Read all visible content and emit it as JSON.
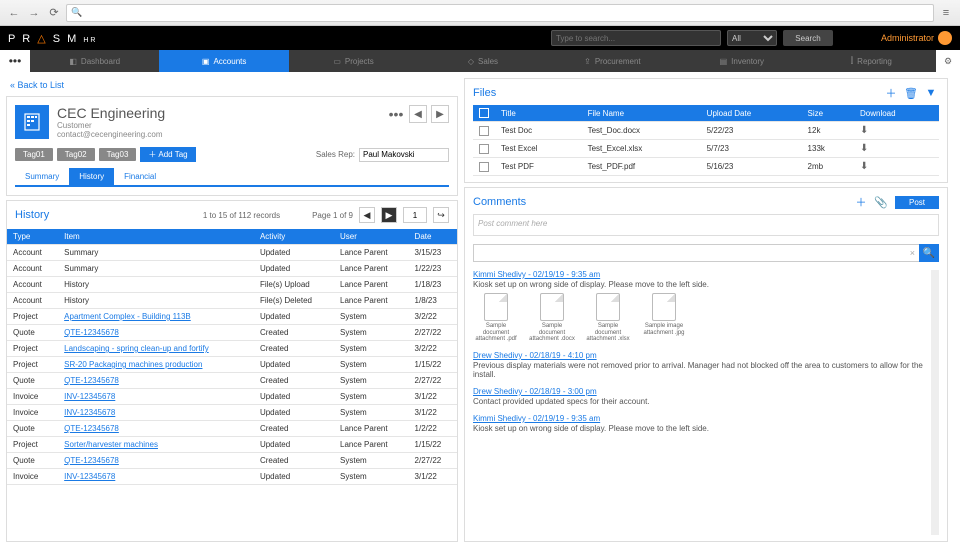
{
  "browser": {
    "url_icon": "🔍"
  },
  "brand": {
    "name": "PRISM",
    "suffix": "HR"
  },
  "search": {
    "placeholder": "Type to search...",
    "filter": "All",
    "button": "Search"
  },
  "user": {
    "role": "Administrator"
  },
  "nav": [
    {
      "icon": "◧",
      "label": "Dashboard"
    },
    {
      "icon": "▣",
      "label": "Accounts",
      "active": true
    },
    {
      "icon": "▭",
      "label": "Projects"
    },
    {
      "icon": "◇",
      "label": "Sales"
    },
    {
      "icon": "⇪",
      "label": "Procurement"
    },
    {
      "icon": "▤",
      "label": "Inventory"
    },
    {
      "icon": "⫿",
      "label": "Reporting"
    }
  ],
  "back_link": "« Back to List",
  "account": {
    "name": "CEC Engineering",
    "type": "Customer",
    "email": "contact@cecengineering.com",
    "tags": [
      "Tag01",
      "Tag02",
      "Tag03"
    ],
    "add_tag": "Add Tag",
    "salesrep_label": "Sales Rep:",
    "salesrep_value": "Paul Makovski",
    "subtabs": {
      "summary": "Summary",
      "history": "History",
      "financial": "Financial"
    }
  },
  "history": {
    "title": "History",
    "records": "1 to 15 of 112 records",
    "page_label": "Page 1 of 9",
    "page_num": "1",
    "cols": {
      "type": "Type",
      "item": "Item",
      "activity": "Activity",
      "user": "User",
      "date": "Date"
    },
    "rows": [
      {
        "type": "Account",
        "item": "Summary",
        "link": false,
        "activity": "Updated",
        "user": "Lance Parent",
        "date": "3/15/23"
      },
      {
        "type": "Account",
        "item": "Summary",
        "link": false,
        "activity": "Updated",
        "user": "Lance Parent",
        "date": "1/22/23"
      },
      {
        "type": "Account",
        "item": "History",
        "link": false,
        "activity": "File(s) Upload",
        "user": "Lance Parent",
        "date": "1/18/23"
      },
      {
        "type": "Account",
        "item": "History",
        "link": false,
        "activity": "File(s) Deleted",
        "user": "Lance Parent",
        "date": "1/8/23"
      },
      {
        "type": "Project",
        "item": "Apartment Complex - Building 113B",
        "link": true,
        "activity": "Updated",
        "user": "System",
        "date": "3/2/22"
      },
      {
        "type": "Quote",
        "item": "QTE-12345678",
        "link": true,
        "activity": "Created",
        "user": "System",
        "date": "2/27/22"
      },
      {
        "type": "Project",
        "item": "Landscaping - spring clean-up and fortify",
        "link": true,
        "activity": "Created",
        "user": "System",
        "date": "3/2/22"
      },
      {
        "type": "Project",
        "item": "SR-20 Packaging machines production",
        "link": true,
        "activity": "Updated",
        "user": "System",
        "date": "1/15/22"
      },
      {
        "type": "Quote",
        "item": "QTE-12345678",
        "link": true,
        "activity": "Created",
        "user": "System",
        "date": "2/27/22"
      },
      {
        "type": "Invoice",
        "item": "INV-12345678",
        "link": true,
        "activity": "Updated",
        "user": "System",
        "date": "3/1/22"
      },
      {
        "type": "Invoice",
        "item": "INV-12345678",
        "link": true,
        "activity": "Updated",
        "user": "System",
        "date": "3/1/22"
      },
      {
        "type": "Quote",
        "item": "QTE-12345678",
        "link": true,
        "activity": "Created",
        "user": "Lance Parent",
        "date": "1/2/22"
      },
      {
        "type": "Project",
        "item": "Sorter/harvester machines",
        "link": true,
        "activity": "Updated",
        "user": "Lance Parent",
        "date": "1/15/22"
      },
      {
        "type": "Quote",
        "item": "QTE-12345678",
        "link": true,
        "activity": "Created",
        "user": "System",
        "date": "2/27/22"
      },
      {
        "type": "Invoice",
        "item": "INV-12345678",
        "link": true,
        "activity": "Updated",
        "user": "System",
        "date": "3/1/22"
      }
    ]
  },
  "files": {
    "title": "Files",
    "cols": {
      "title": "Title",
      "filename": "File Name",
      "upload": "Upload Date",
      "size": "Size",
      "download": "Download"
    },
    "rows": [
      {
        "title": "Test Doc",
        "filename": "Test_Doc.docx",
        "upload": "5/22/23",
        "size": "12k"
      },
      {
        "title": "Test Excel",
        "filename": "Test_Excel.xlsx",
        "upload": "5/7/23",
        "size": "133k"
      },
      {
        "title": "Test PDF",
        "filename": "Test_PDF.pdf",
        "upload": "5/16/23",
        "size": "2mb"
      }
    ]
  },
  "comments": {
    "title": "Comments",
    "post_button": "Post",
    "placeholder": "Post comment here",
    "search_placeholder": "",
    "items": [
      {
        "meta": "Kimmi Shedivy - 02/19/19 - 9:35 am",
        "body": "Kiosk set up on wrong side of display. Please move to the left side.",
        "attachments": [
          {
            "label": "Sample document attachment .pdf"
          },
          {
            "label": "Sample document attachment .docx"
          },
          {
            "label": "Sample document attachment .xlsx"
          },
          {
            "label": "Sample image attachment .jpg"
          }
        ]
      },
      {
        "meta": "Drew Shedivy - 02/18/19 - 4:10 pm",
        "body": "Previous display materials were not removed prior to arrival. Manager had not blocked off the area to customers to allow for the install."
      },
      {
        "meta": "Drew Shedivy - 02/18/19 - 3:00 pm",
        "body": "Contact provided updated specs for their account."
      },
      {
        "meta": "Kimmi Shedivy - 02/19/19 - 9:35 am",
        "body": "Kiosk set up on wrong side of display. Please move to the left side."
      }
    ]
  }
}
